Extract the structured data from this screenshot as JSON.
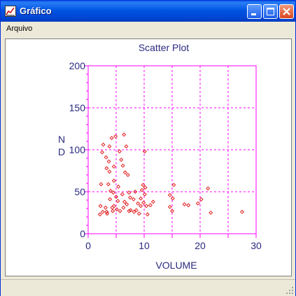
{
  "window": {
    "title": "Gráfico",
    "app_icon": "chart-window-icon"
  },
  "title_buttons": {
    "minimize": "minimize-icon",
    "maximize": "maximize-icon",
    "close": "close-icon"
  },
  "menu": {
    "items": [
      "Arquivo"
    ]
  },
  "colors": {
    "axis": "#ff00ff",
    "points": "#e02020",
    "text": "#2a2a80",
    "titlebar": "#0054e3"
  },
  "chart_data": {
    "type": "scatter",
    "title": "Scatter Plot",
    "xlabel": "VOLUME",
    "ylabel": "N\nD",
    "xlim": [
      0,
      30
    ],
    "ylim": [
      0,
      200
    ],
    "xticks": [
      0,
      10,
      20,
      30
    ],
    "yticks": [
      0,
      50,
      100,
      150,
      200
    ],
    "grid": true,
    "points": [
      [
        2.7,
        106
      ],
      [
        2.5,
        97
      ],
      [
        3.2,
        91
      ],
      [
        3.8,
        104
      ],
      [
        4.2,
        114
      ],
      [
        4.9,
        116
      ],
      [
        6.4,
        118
      ],
      [
        6.8,
        104
      ],
      [
        5.6,
        98
      ],
      [
        3.7,
        86
      ],
      [
        3.3,
        78
      ],
      [
        4.6,
        80
      ],
      [
        5.9,
        88
      ],
      [
        6.2,
        81
      ],
      [
        3.8,
        74
      ],
      [
        6.6,
        73
      ],
      [
        7.1,
        70
      ],
      [
        4.6,
        63
      ],
      [
        3.6,
        59
      ],
      [
        2.3,
        59
      ],
      [
        5.4,
        56
      ],
      [
        4.0,
        51
      ],
      [
        4.5,
        49
      ],
      [
        6.1,
        47
      ],
      [
        7.3,
        49
      ],
      [
        5.0,
        44
      ],
      [
        3.9,
        41
      ],
      [
        5.3,
        39
      ],
      [
        6.5,
        38
      ],
      [
        7.5,
        43
      ],
      [
        8.1,
        41
      ],
      [
        6.9,
        35
      ],
      [
        2.2,
        33
      ],
      [
        3.1,
        31
      ],
      [
        4.3,
        31
      ],
      [
        4.6,
        33
      ],
      [
        5.1,
        29
      ],
      [
        2.6,
        26
      ],
      [
        3.3,
        26
      ],
      [
        4.4,
        27
      ],
      [
        5.7,
        27
      ],
      [
        2.1,
        23
      ],
      [
        3.4,
        24
      ],
      [
        6.3,
        31
      ],
      [
        7.6,
        28
      ],
      [
        7.3,
        27
      ],
      [
        8.2,
        26
      ],
      [
        8.6,
        28
      ],
      [
        9.4,
        33
      ],
      [
        9.1,
        24
      ],
      [
        8.9,
        36
      ],
      [
        9.4,
        42
      ],
      [
        9.9,
        37
      ],
      [
        10.4,
        33
      ],
      [
        10.6,
        23
      ],
      [
        11.1,
        34
      ],
      [
        10.1,
        47
      ],
      [
        11.6,
        38
      ],
      [
        9.6,
        52
      ],
      [
        10.2,
        55
      ],
      [
        9.8,
        58
      ],
      [
        10.1,
        98
      ],
      [
        14.6,
        46
      ],
      [
        15.3,
        58
      ],
      [
        15.1,
        42
      ],
      [
        14.6,
        32
      ],
      [
        15.0,
        27
      ],
      [
        17.2,
        35
      ],
      [
        17.9,
        34
      ],
      [
        19.6,
        36
      ],
      [
        20.2,
        41
      ],
      [
        21.4,
        54
      ],
      [
        21.9,
        25
      ],
      [
        27.5,
        26
      ],
      [
        8.4,
        50
      ]
    ]
  }
}
